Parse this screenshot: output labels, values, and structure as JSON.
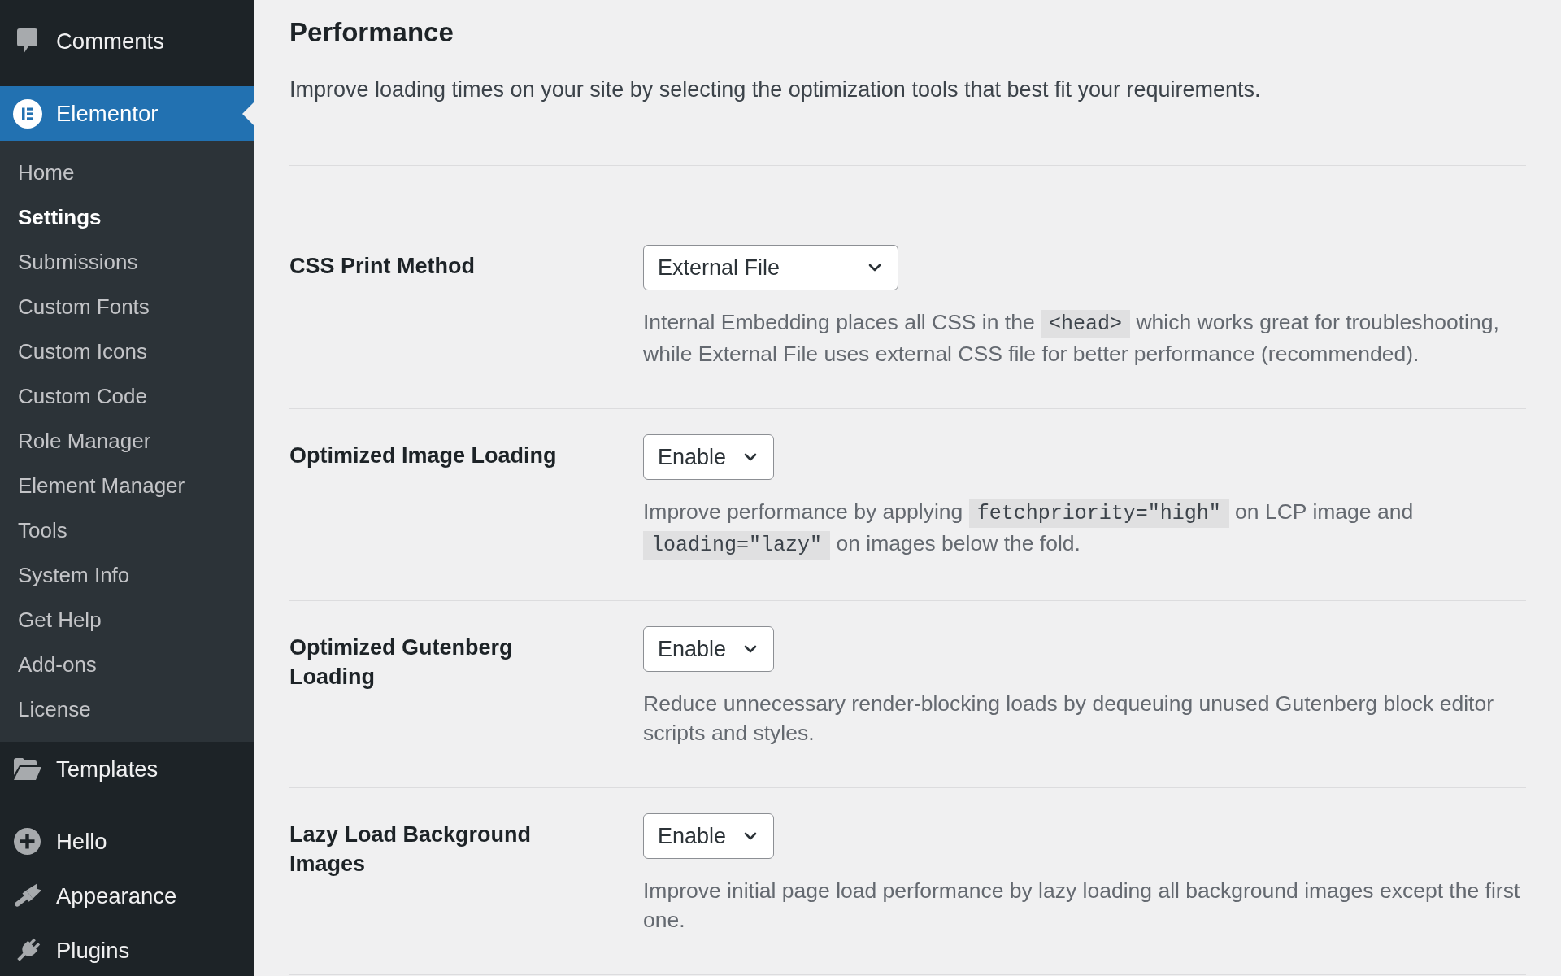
{
  "sidebar": {
    "groups": [
      {
        "items": [
          {
            "label": "Comments",
            "selected": false
          }
        ]
      },
      {
        "items": [
          {
            "label": "Elementor",
            "selected": true,
            "children": [
              {
                "label": "Home",
                "selected": false
              },
              {
                "label": "Settings",
                "selected": true
              },
              {
                "label": "Submissions",
                "selected": false
              },
              {
                "label": "Custom Fonts",
                "selected": false
              },
              {
                "label": "Custom Icons",
                "selected": false
              },
              {
                "label": "Custom Code",
                "selected": false
              },
              {
                "label": "Role Manager",
                "selected": false
              },
              {
                "label": "Element Manager",
                "selected": false
              },
              {
                "label": "Tools",
                "selected": false
              },
              {
                "label": "System Info",
                "selected": false
              },
              {
                "label": "Get Help",
                "selected": false
              },
              {
                "label": "Add-ons",
                "selected": false
              },
              {
                "label": "License",
                "selected": false
              }
            ]
          },
          {
            "label": "Templates",
            "selected": false
          }
        ]
      },
      {
        "items": [
          {
            "label": "Hello",
            "selected": false
          },
          {
            "label": "Appearance",
            "selected": false
          },
          {
            "label": "Plugins",
            "selected": false
          }
        ]
      }
    ]
  },
  "page": {
    "title": "Performance",
    "intro": "Improve loading times on your site by selecting the optimization tools that best fit your requirements."
  },
  "settings": [
    {
      "label": "CSS Print Method",
      "value": "External File",
      "description": [
        {
          "kind": "text",
          "text": "Internal Embedding places all CSS in the"
        },
        {
          "kind": "code",
          "text": "<head>"
        },
        {
          "kind": "text",
          "text": "which works great for troubleshooting, while External File uses external CSS file for better performance (recommended)."
        }
      ]
    },
    {
      "label": "Optimized Image Loading",
      "value": "Enable",
      "description": [
        {
          "kind": "text",
          "text": "Improve performance by applying"
        },
        {
          "kind": "code",
          "text": "fetchpriority=\"high\""
        },
        {
          "kind": "text",
          "text": "on LCP image and"
        },
        {
          "kind": "code",
          "text": "loading=\"lazy\""
        },
        {
          "kind": "text",
          "text": "on images below the fold."
        }
      ]
    },
    {
      "label": "Optimized Gutenberg Loading",
      "value": "Enable",
      "description": [
        {
          "kind": "text",
          "text": "Reduce unnecessary render-blocking loads by dequeuing unused Gutenberg block editor scripts and styles."
        }
      ]
    },
    {
      "label": "Lazy Load Background Images",
      "value": "Enable",
      "description": [
        {
          "kind": "text",
          "text": "Improve initial page load performance by lazy loading all background images except the first one."
        }
      ]
    }
  ]
}
